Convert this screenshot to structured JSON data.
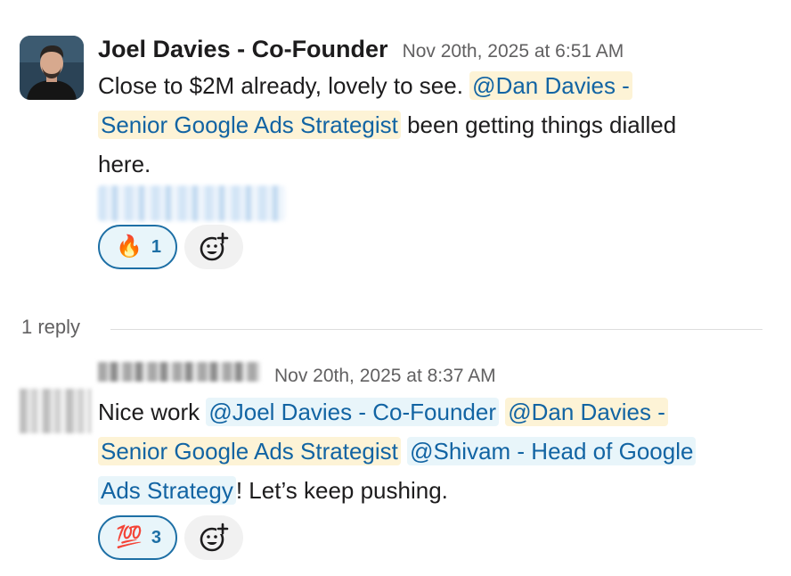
{
  "messages": [
    {
      "author": "Joel Davies - Co-Founder",
      "timestamp": "Nov 20th, 2025 at 6:51 AM",
      "text_before": "Close to $2M already, lovely to see. ",
      "mention1_line1": "@Dan Davies -",
      "mention1_line2": "Senior Google Ads Strategist",
      "text_after": " been getting things dialled",
      "text_end": "here.",
      "reaction": {
        "emoji": "🔥",
        "count": "1"
      },
      "add_reaction_icon": "emoji-add-icon"
    },
    {
      "timestamp": "Nov 20th, 2025 at 8:37 AM",
      "text_before": "Nice work ",
      "mention_joel": "@Joel Davies - Co-Founder",
      "mention_dan_line1": "@Dan Davies -",
      "mention_dan_line2": "Senior Google Ads Strategist",
      "mention_shivam_line1": "@Shivam - Head of Google",
      "mention_shivam_line2": "Ads Strategy",
      "text_after": "! Let’s keep pushing.",
      "reaction": {
        "emoji": "💯",
        "count": "3"
      },
      "add_reaction_icon": "emoji-add-icon"
    }
  ],
  "thread": {
    "reply_count": "1 reply"
  },
  "colors": {
    "mention_link": "#1264a3",
    "mention_self_bg": "#fdf3d6",
    "mention_other_bg": "#e8f5fa",
    "reaction_border": "#1d6fa5"
  }
}
